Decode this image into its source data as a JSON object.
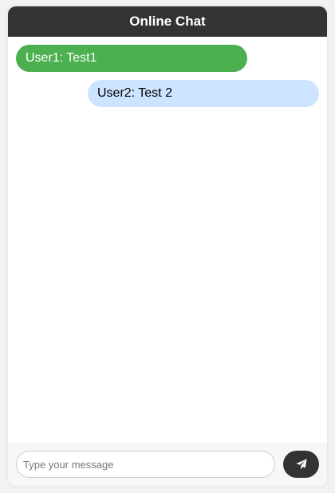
{
  "header": {
    "title": "Online Chat"
  },
  "messages": [
    {
      "text": "User1: Test1",
      "color": "#4caf50"
    },
    {
      "text": "User2: Test 2",
      "color": "#cce4ff"
    }
  ],
  "composer": {
    "placeholder": "Type your message",
    "value": "",
    "send_icon": "paper-plane-icon"
  },
  "colors": {
    "header_bg": "#333333",
    "send_button_bg": "#333333"
  }
}
